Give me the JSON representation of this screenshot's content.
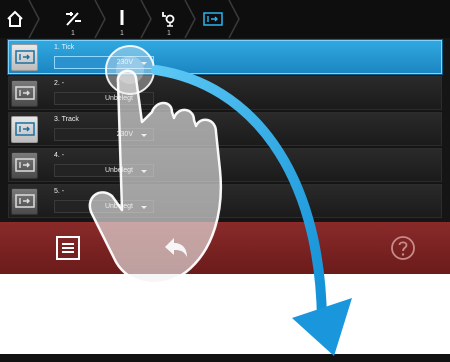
{
  "topbar": {
    "items": [
      {
        "name": "home-icon",
        "count": ""
      },
      {
        "name": "pencil-tool-icon",
        "count": "1"
      },
      {
        "name": "line-tool-icon",
        "count": "1"
      },
      {
        "name": "lamp-icon",
        "count": "1"
      },
      {
        "name": "exit-sign-icon",
        "count": ""
      }
    ]
  },
  "list": {
    "rows": [
      {
        "title": "1. Tick",
        "value": "230V",
        "selected": true
      },
      {
        "title": "2. -",
        "value": "Unbelegt",
        "selected": false
      },
      {
        "title": "3. Track",
        "value": "230V",
        "selected": false
      },
      {
        "title": "4. -",
        "value": "Unbelegt",
        "selected": false
      },
      {
        "title": "5. -",
        "value": "Unbelegt",
        "selected": false
      }
    ]
  },
  "bottombar": {
    "menu_icon": "menu-icon",
    "back_icon": "back-arrow-icon",
    "help_icon": "help-icon"
  },
  "colors": {
    "selection": "#2a9bd8",
    "bottom_bar": "#7a2222",
    "gesture_arrow": "#1aa6e6"
  }
}
